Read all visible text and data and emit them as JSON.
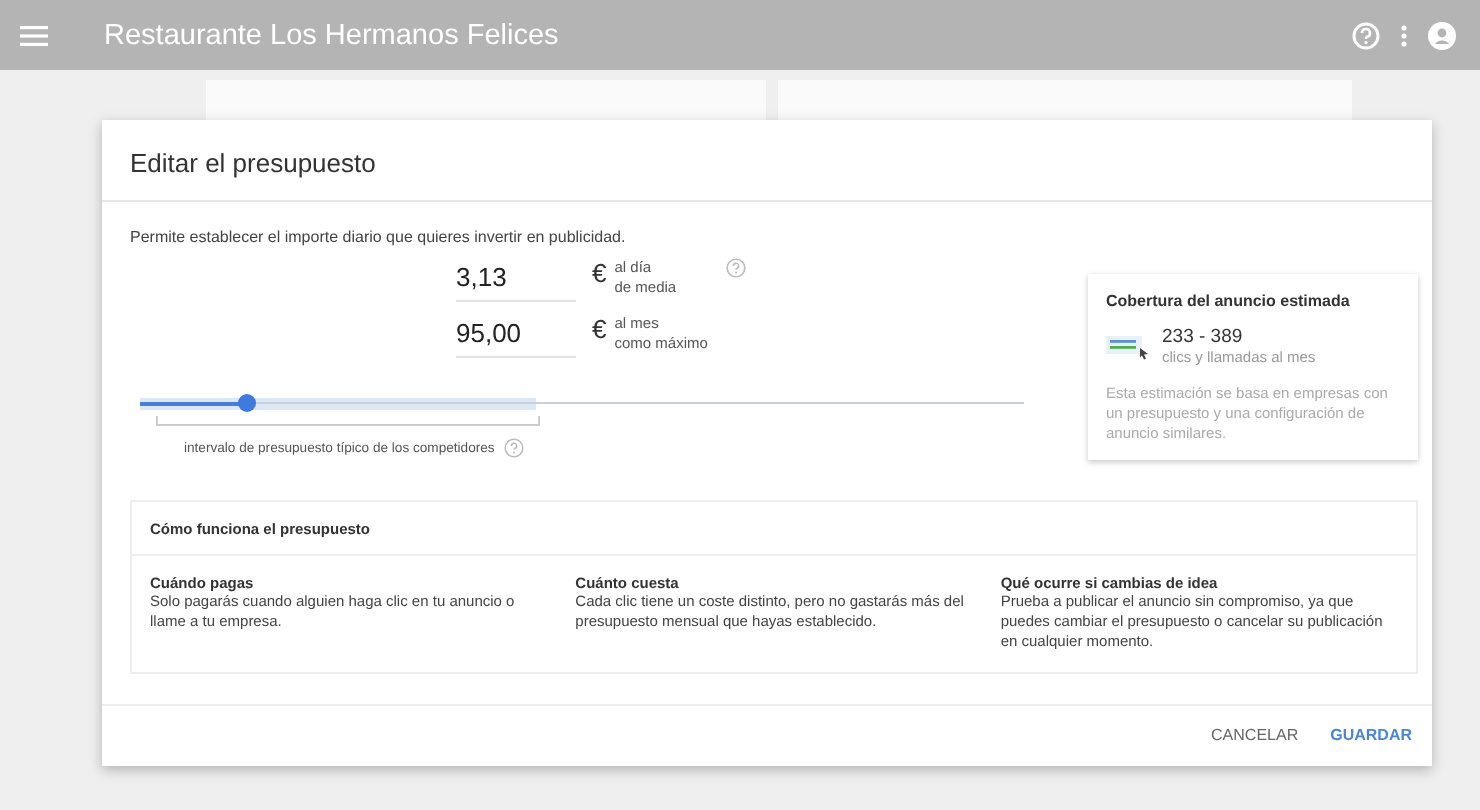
{
  "app_bar": {
    "title": "Restaurante Los Hermanos Felices"
  },
  "dialog": {
    "title": "Editar el presupuesto",
    "description": "Permite establecer el importe diario que quieres invertir en publicidad.",
    "budget_fields": [
      {
        "value": "3,13",
        "currency": "€",
        "caption_1": "al día",
        "caption_2": "de media",
        "help": true
      },
      {
        "value": "95,00",
        "currency": "€",
        "caption_1": "al mes",
        "caption_2": "como máximo",
        "help": false
      }
    ],
    "slider": {
      "level": 0.12,
      "caption": "intervalo de presupuesto típico de los competidores"
    },
    "coverage": {
      "title": "Cobertura del anuncio estimada",
      "range": "233 - 389",
      "unit": "clics y llamadas al mes",
      "note": "Esta estimación se basa en empresas con un presupuesto y una configuración de anuncio similares."
    },
    "how_it_works": {
      "title": "Cómo funciona el presupuesto",
      "items": [
        {
          "heading": "Cuándo pagas",
          "text": "Solo pagarás cuando alguien haga clic en tu anuncio o llame a tu empresa."
        },
        {
          "heading": "Cuánto cuesta",
          "text": "Cada clic tiene un coste distinto, pero no gastarás más del presupuesto mensual que hayas establecido."
        },
        {
          "heading": "Qué ocurre si cambias de idea",
          "text": "Prueba a publicar el anuncio sin compromiso, ya que puedes cambiar el presupuesto o cancelar su publicación en cualquier momento."
        }
      ]
    },
    "buttons": [
      {
        "label": "CANCELAR",
        "kind": "secondary"
      },
      {
        "label": "GUARDAR",
        "kind": "primary"
      }
    ]
  }
}
